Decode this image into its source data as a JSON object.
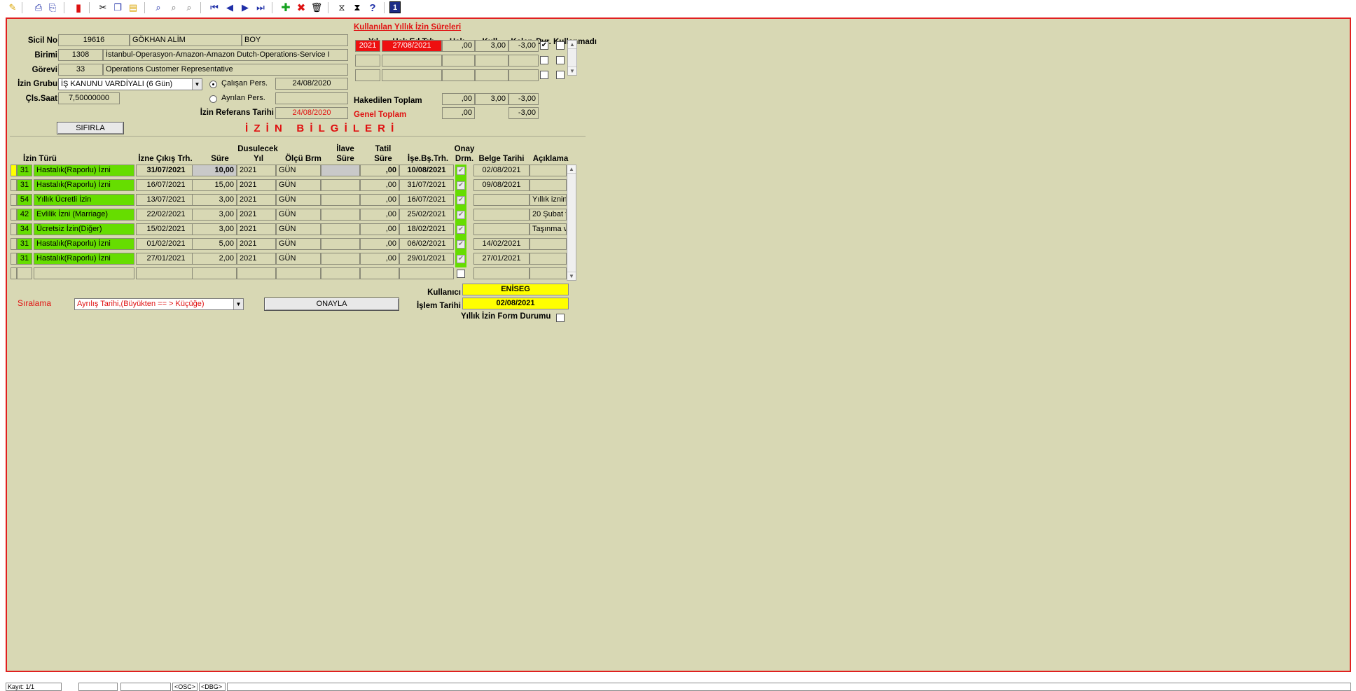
{
  "toolbar": {
    "icons": [
      "eraser-icon",
      "print-icon",
      "print-preview-icon",
      "exit-door-icon",
      "cut-icon",
      "copy-icon",
      "paste-icon",
      "find-icon",
      "find-next-icon",
      "find-replace-icon",
      "first-record-icon",
      "prev-record-icon",
      "next-record-icon",
      "last-record-icon",
      "add-record-icon",
      "delete-record-icon",
      "trash-icon",
      "filter-icon",
      "clear-filter-icon",
      "help-icon",
      "book-icon"
    ],
    "help_glyph": "?",
    "book_glyph": "1"
  },
  "employee": {
    "sicil_label": "Sicil No",
    "sicil_no": "19616",
    "name": "GÖKHAN ALİM",
    "name_extra": "BOY",
    "birim_label": "Birimi",
    "birim_code": "1308",
    "birim_name": "İstanbul-Operasyon-Amazon-Amazon Dutch-Operations-Service I",
    "gorev_label": "Görevi",
    "gorev_code": "33",
    "gorev_name": "Operations Customer Representative",
    "izin_grubu_label": "İzin Grubu",
    "izin_grubu": "İŞ KANUNU VARDİYALI (6 Gün)",
    "cls_saat_label": "Çls.Saat",
    "cls_saat": "7,50000000",
    "calisan_label": "Çalışan Pers.",
    "calisan_date": "24/08/2020",
    "ayrilan_label": "Ayrılan Pers.",
    "ayrilan_date": "",
    "ref_label": "İzin Referans Tarihi",
    "ref_date": "24/08/2020",
    "reset_button": "SIFIRLA"
  },
  "annual": {
    "title": "Kullanılan Yıllık İzin Süreleri",
    "headers": {
      "yil": "Yıl",
      "hak_ed": "Hak.Ed.Trh.",
      "hak": "Hak.",
      "kull": "Kull.",
      "kalan": "Kalan",
      "dvr": "Dvr.",
      "kullanmadi": "Kullanmadı"
    },
    "rows": [
      {
        "yil": "2021",
        "hak_ed": "27/08/2021",
        "hak": ",00",
        "kull": "3,00",
        "kalan": "-3,00",
        "dvr": true,
        "kullanmadi": false
      },
      {
        "yil": "",
        "hak_ed": "",
        "hak": "",
        "kull": "",
        "kalan": "",
        "dvr": false,
        "kullanmadi": false
      },
      {
        "yil": "",
        "hak_ed": "",
        "hak": "",
        "kull": "",
        "kalan": "",
        "dvr": false,
        "kullanmadi": false
      }
    ],
    "hakedilen_label": "Hakedilen Toplam",
    "hakedilen": {
      "hak": ",00",
      "kull": "3,00",
      "kalan": "-3,00"
    },
    "genel_label": "Genel Toplam",
    "genel": {
      "hak": ",00",
      "kalan": "-3,00"
    }
  },
  "leave": {
    "section_title": "İ Z İ N   B İ L G İ L E R İ",
    "headers": {
      "izin_turu": "İzin Türü",
      "cikis": "İzne Çıkış Trh.",
      "sure": "Süre",
      "dusulecek_1": "Dusulecek",
      "dusulecek_2": "Yıl",
      "olcu": "Ölçü Brm",
      "ilave_1": "İlave",
      "ilave_2": "Süre",
      "tatil_1": "Tatil",
      "tatil_2": "Süre",
      "isebas": "İşe.Bş.Trh.",
      "onay_1": "Onay",
      "onay_2": "Drm.",
      "belge": "Belge Tarihi",
      "aciklama": "Açıklama"
    },
    "rows": [
      {
        "code": "31",
        "type": "Hastalık(Raporlu) İzni",
        "cikis": "31/07/2021",
        "sure": "10,00",
        "yil": "2021",
        "olcu": "GÜN",
        "ilave": "",
        "tatil": ",00",
        "isebas": "10/08/2021",
        "onay": true,
        "belge": "02/08/2021",
        "aciklama": ""
      },
      {
        "code": "31",
        "type": "Hastalık(Raporlu) İzni",
        "cikis": "16/07/2021",
        "sure": "15,00",
        "yil": "2021",
        "olcu": "GÜN",
        "ilave": "",
        "tatil": ",00",
        "isebas": "31/07/2021",
        "onay": true,
        "belge": "09/08/2021",
        "aciklama": ""
      },
      {
        "code": "54",
        "type": "Yıllık Ücretli İzin",
        "cikis": "13/07/2021",
        "sure": "3,00",
        "yil": "2021",
        "olcu": "GÜN",
        "ilave": "",
        "tatil": ",00",
        "isebas": "16/07/2021",
        "onay": true,
        "belge": "",
        "aciklama": "Yıllık iznin"
      },
      {
        "code": "42",
        "type": "Evlilik İzni (Marriage)",
        "cikis": "22/02/2021",
        "sure": "3,00",
        "yil": "2021",
        "olcu": "GÜN",
        "ilave": "",
        "tatil": ",00",
        "isebas": "25/02/2021",
        "onay": true,
        "belge": "",
        "aciklama": "20 Şubat t"
      },
      {
        "code": "34",
        "type": "Ücretsiz İzin(Diğer)",
        "cikis": "15/02/2021",
        "sure": "3,00",
        "yil": "2021",
        "olcu": "GÜN",
        "ilave": "",
        "tatil": ",00",
        "isebas": "18/02/2021",
        "onay": true,
        "belge": "",
        "aciklama": "Taşınma v"
      },
      {
        "code": "31",
        "type": "Hastalık(Raporlu) İzni",
        "cikis": "01/02/2021",
        "sure": "5,00",
        "yil": "2021",
        "olcu": "GÜN",
        "ilave": "",
        "tatil": ",00",
        "isebas": "06/02/2021",
        "onay": true,
        "belge": "14/02/2021",
        "aciklama": ""
      },
      {
        "code": "31",
        "type": "Hastalık(Raporlu) İzni",
        "cikis": "27/01/2021",
        "sure": "2,00",
        "yil": "2021",
        "olcu": "GÜN",
        "ilave": "",
        "tatil": ",00",
        "isebas": "29/01/2021",
        "onay": true,
        "belge": "27/01/2021",
        "aciklama": ""
      },
      {
        "code": "",
        "type": "",
        "cikis": "",
        "sure": "",
        "yil": "",
        "olcu": "",
        "ilave": "",
        "tatil": "",
        "isebas": "",
        "onay": false,
        "belge": "",
        "aciklama": ""
      }
    ]
  },
  "bottom": {
    "siralama_label": "Sıralama",
    "siralama_value": "Ayrılış Tarihi,(Büyükten == > Küçüğe)",
    "onayla_button": "ONAYLA",
    "kullanici_label": "Kullanıcı",
    "kullanici": "ENİSEG",
    "islem_label": "İşlem Tarihi",
    "islem_tarihi": "02/08/2021",
    "form_label": "Yıllık İzin Form Durumu",
    "form_checked": false
  },
  "statusbar": {
    "kayit": "Kayıt: 1/1",
    "osc": "<OSC>",
    "dbg": "<DBG>"
  },
  "colors": {
    "panel_bg": "#d8d8b4",
    "panel_border": "#e02020",
    "green": "#66dd00",
    "yellow": "#ffff00",
    "red": "#ee1010"
  }
}
